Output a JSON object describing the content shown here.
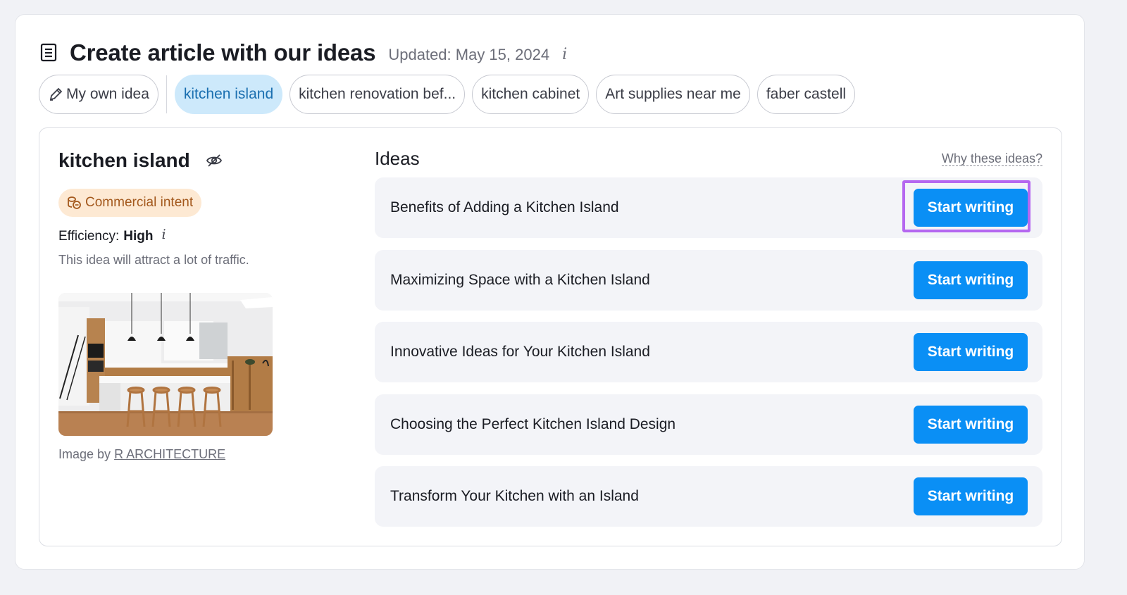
{
  "header": {
    "title": "Create article with our ideas",
    "updated": "Updated: May 15, 2024",
    "info_glyph": "i",
    "icon": "document-icon"
  },
  "chips": {
    "own_idea": "My own idea",
    "items": [
      {
        "label": "kitchen island",
        "active": true
      },
      {
        "label": "kitchen renovation bef...",
        "active": false
      },
      {
        "label": "kitchen cabinet",
        "active": false
      },
      {
        "label": "Art supplies near me",
        "active": false
      },
      {
        "label": "faber castell",
        "active": false
      }
    ]
  },
  "keyword": {
    "title": "kitchen island",
    "intent": "Commercial intent",
    "efficiency_label": "Efficiency:",
    "efficiency_value": "High",
    "efficiency_desc": "This idea will attract a lot of traffic.",
    "image_credit_prefix": "Image by",
    "image_credit_link": "R ARCHITECTURE"
  },
  "ideas": {
    "title": "Ideas",
    "why_link": "Why these ideas?",
    "button_label": "Start writing",
    "items": [
      "Benefits of Adding a Kitchen Island",
      "Maximizing Space with a Kitchen Island",
      "Innovative Ideas for Your Kitchen Island",
      "Choosing the Perfect Kitchen Island Design",
      "Transform Your Kitchen with an Island"
    ],
    "highlighted_index": 0
  },
  "colors": {
    "accent": "#0a8ff5",
    "active_chip_bg": "#cde9fb",
    "intent_bg": "#fde9d3",
    "highlight": "#b567f0"
  }
}
